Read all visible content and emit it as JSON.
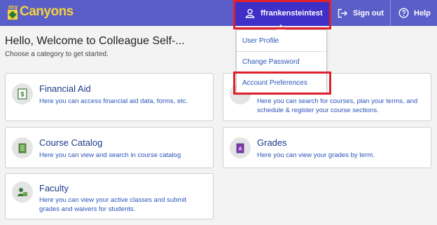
{
  "header": {
    "logo_prefix": "my",
    "logo_text": "Canyons",
    "username": "ffrankensteintest",
    "signout_label": "Sign out",
    "help_label": "Help",
    "bg_color": "#5a5ec8"
  },
  "welcome": {
    "title": "Hello, Welcome to Colleague Self-...",
    "subtitle": "Choose a category to get started."
  },
  "user_menu": {
    "items": [
      {
        "label": "User Profile"
      },
      {
        "label": "Change Password"
      },
      {
        "label": "Account Preferences"
      }
    ]
  },
  "cards": [
    {
      "title": "Financial Aid",
      "desc": "Here you can access financial aid data, forms, etc.",
      "icon": "financial-aid-icon"
    },
    {
      "title": "",
      "desc_line1": "Here you can search for courses, plan your terms, and",
      "desc_line2": "schedule & register your course sections.",
      "icon": "planning-icon"
    },
    {
      "title": "Course Catalog",
      "desc": "Here you can view and search in course catalog",
      "icon": "course-catalog-icon"
    },
    {
      "title": "Grades",
      "desc": "Here you can view your grades by term.",
      "icon": "grades-icon"
    },
    {
      "title": "Faculty",
      "desc_line1": "Here you can view your active classes and submit",
      "desc_line2": "grades and waivers for students.",
      "icon": "faculty-icon"
    }
  ],
  "highlight_color": "#e0202a"
}
